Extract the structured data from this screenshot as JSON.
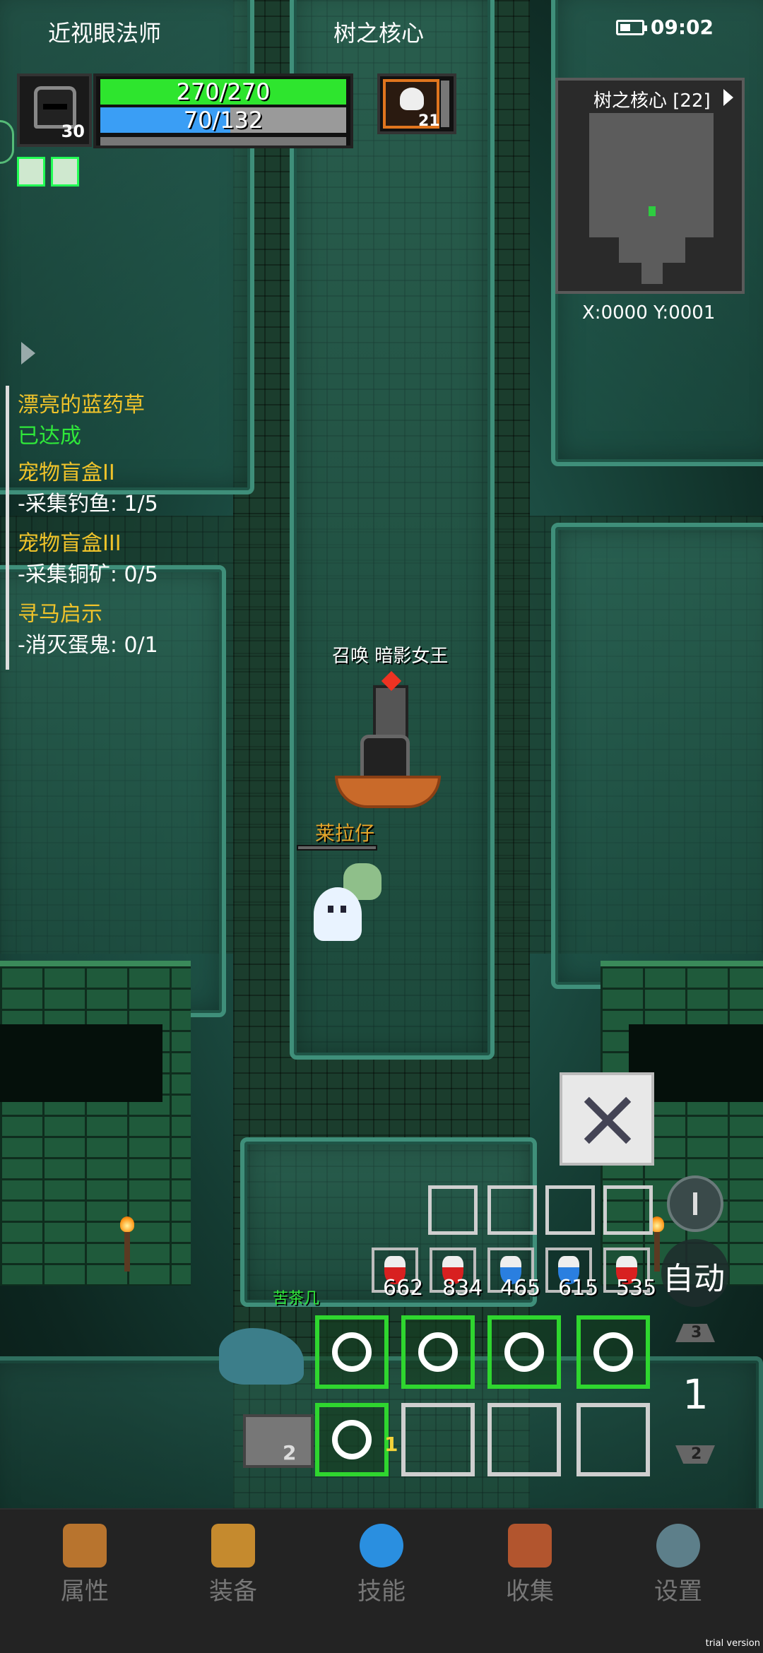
{
  "status_bar": {
    "left_text": "近视眼法师",
    "center_text": "树之核心",
    "time": "09:02"
  },
  "player": {
    "level": "30",
    "hp": "270/270",
    "mp": "70/132",
    "mp_fraction": 0.53
  },
  "target": {
    "level": "21"
  },
  "minimap": {
    "title": "树之核心 [22]",
    "coords": "X:0000  Y:0001"
  },
  "quests": [
    {
      "title": "漂亮的蓝药草",
      "status": "已达成"
    },
    {
      "title": "宠物盲盒II",
      "progress": "-采集钓鱼: 1/5"
    },
    {
      "title": "宠物盲盒III",
      "progress": "-采集铜矿: 0/5"
    },
    {
      "title": "寻马启示",
      "progress": "-消灭蛋鬼: 0/1"
    }
  ],
  "world": {
    "summon_label": "召唤 暗影女王",
    "npc_name": "莱拉仔",
    "pet_name": "苦茶几",
    "pedestal_number": "2"
  },
  "potions": [
    "662",
    "834",
    "465",
    "615",
    "535"
  ],
  "controls": {
    "auto_label": "自动",
    "page_number": "1",
    "up_number": "3",
    "down_number": "2",
    "skill_key": "1"
  },
  "nav": [
    {
      "label": "属性",
      "icon": "helmet-icon",
      "color": "#b8742e"
    },
    {
      "label": "装备",
      "icon": "pouch-icon",
      "color": "#c58a2e"
    },
    {
      "label": "技能",
      "icon": "skill-orb-icon",
      "color": "#2a8fe0"
    },
    {
      "label": "收集",
      "icon": "book-icon",
      "color": "#b2552e"
    },
    {
      "label": "设置",
      "icon": "gear-icon",
      "color": "#5d7f8a"
    }
  ],
  "watermark": "trial version",
  "colors": {
    "hp": "#2ee52e",
    "mp": "#3a9ef5",
    "quest_title": "#f0c32a",
    "quest_done": "#2fe83a",
    "skill_border": "#2fd62f"
  }
}
